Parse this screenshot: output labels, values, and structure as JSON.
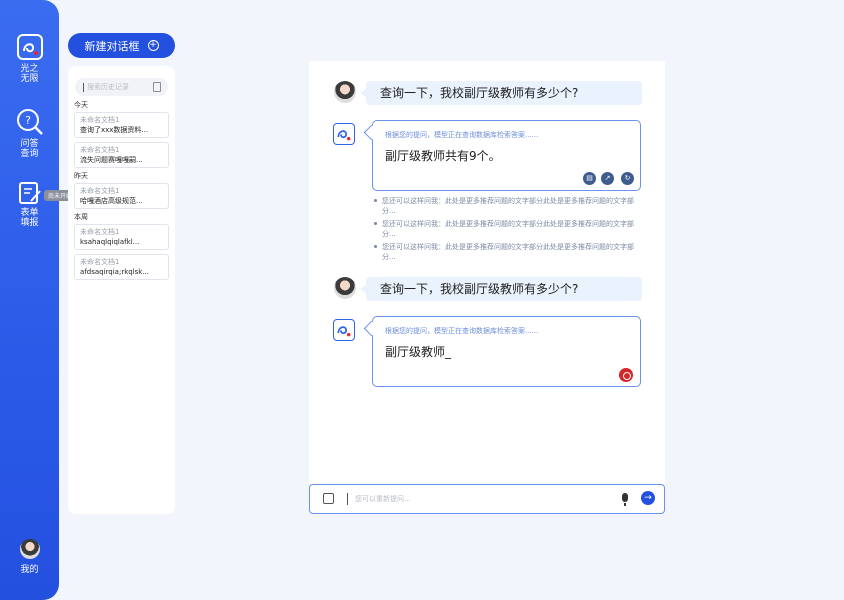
{
  "sidebar": {
    "logo_label": "光之\n无限",
    "qa_label": "问答\n查询",
    "form_label": "表单\n填报",
    "tooltip": "尚未开始",
    "mine_label": "我的"
  },
  "history": {
    "new_button": "新建对话框",
    "search_placeholder": "搜索历史记录",
    "groups": [
      {
        "label": "今天",
        "items": [
          {
            "title": "未命名文档1",
            "preview": "查询了xxx数据资料..."
          },
          {
            "title": "未命名文档1",
            "preview": "流失问题赛嘎嘎嗣..."
          }
        ]
      },
      {
        "label": "昨天",
        "items": [
          {
            "title": "未命名文档1",
            "preview": "哈嘎酒店高级规范..."
          }
        ]
      },
      {
        "label": "本周",
        "items": [
          {
            "title": "未命名文档1",
            "preview": "ksahaqlqiqlafkl..."
          },
          {
            "title": "未命名文档1",
            "preview": "afdsaqirqia;rkqlsk..."
          }
        ]
      }
    ]
  },
  "chat": {
    "messages": [
      {
        "role": "user",
        "text": "查询一下，我校副厅级教师有多少个?"
      },
      {
        "role": "bot",
        "status": "根据您的提问，模型正在查询数据库检索答案......",
        "text": "副厅级教师共有9个。"
      },
      {
        "role": "user",
        "text": "查询一下，我校副厅级教师有多少个?"
      },
      {
        "role": "bot",
        "status": "根据您的提问，模型正在查询数据库检索答案......",
        "text": "副厅级教师_"
      }
    ],
    "suggestions": [
      "您还可以这样问我：此处是更多推荐问题的文字部分此处是更多推荐问题的文字部分...",
      "您还可以这样问我：此处是更多推荐问题的文字部分此处是更多推荐问题的文字部分...",
      "您还可以这样问我：此处是更多推荐问题的文字部分此处是更多推荐问题的文字部分..."
    ]
  },
  "input": {
    "placeholder": "您可以重新提问..."
  },
  "colors": {
    "accent": "#2450e0",
    "bubble_user": "#eaf2fe",
    "stop": "#d6242b"
  }
}
